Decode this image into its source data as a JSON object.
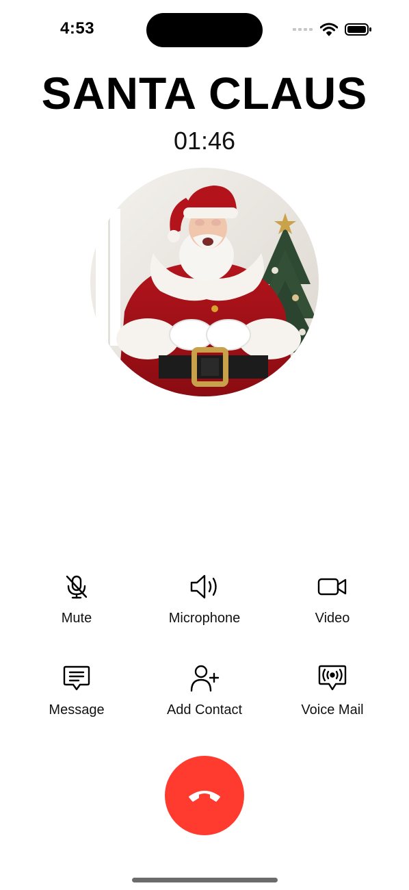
{
  "status_bar": {
    "time": "4:53"
  },
  "call": {
    "caller_name": "SANTA CLAUS",
    "duration": "01:46",
    "avatar_icon": "santa-claus-photo"
  },
  "actions": [
    {
      "label": "Mute",
      "icon": "mic-off-icon"
    },
    {
      "label": "Microphone",
      "icon": "speaker-icon"
    },
    {
      "label": "Video",
      "icon": "video-camera-icon"
    },
    {
      "label": "Message",
      "icon": "message-icon"
    },
    {
      "label": "Add Contact",
      "icon": "add-contact-icon"
    },
    {
      "label": "Voice Mail",
      "icon": "voicemail-icon"
    }
  ],
  "end_call": {
    "icon": "phone-hangup-icon"
  },
  "colors": {
    "end_call": "#ff3b30",
    "background": "#ffffff",
    "text": "#000000"
  }
}
